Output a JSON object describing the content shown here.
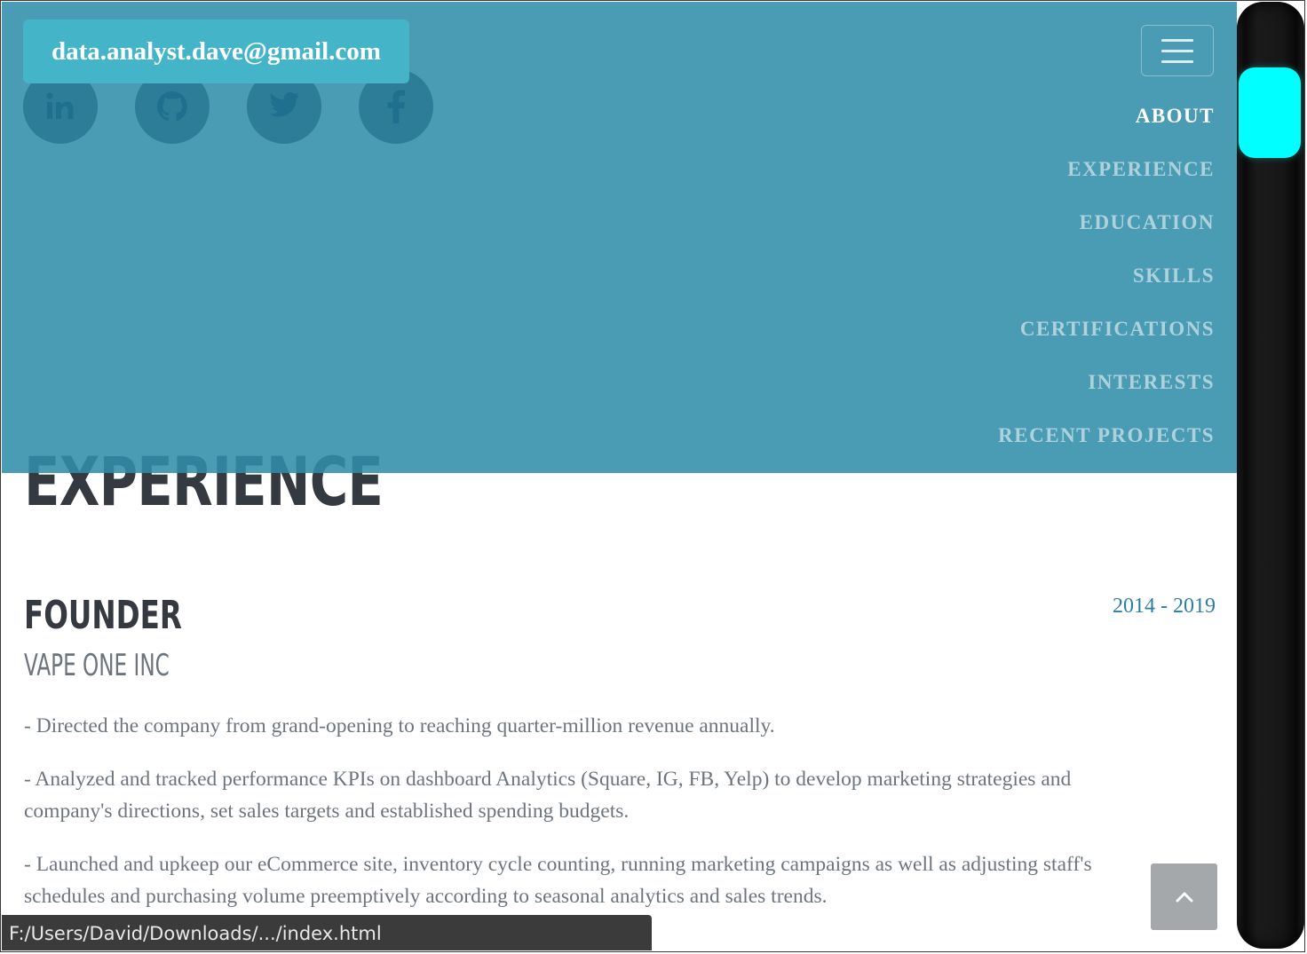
{
  "header": {
    "email": "data.analyst.dave@gmail.com",
    "social": [
      {
        "icon": "linkedin-icon"
      },
      {
        "icon": "github-icon"
      },
      {
        "icon": "twitter-icon"
      },
      {
        "icon": "facebook-icon"
      }
    ],
    "menu_icon": "hamburger-menu-icon"
  },
  "nav": {
    "items": [
      {
        "label": "ABOUT",
        "active": true
      },
      {
        "label": "EXPERIENCE",
        "active": false
      },
      {
        "label": "EDUCATION",
        "active": false
      },
      {
        "label": "SKILLS",
        "active": false
      },
      {
        "label": "CERTIFICATIONS",
        "active": false
      },
      {
        "label": "INTERESTS",
        "active": false
      },
      {
        "label": "RECENT PROJECTS",
        "active": false
      }
    ]
  },
  "section": {
    "title": "EXPERIENCE"
  },
  "job": {
    "title": "FOUNDER",
    "company": "VAPE ONE INC",
    "dates": "2014 - 2019",
    "duties": [
      "- Directed the company from grand-opening to reaching quarter-million revenue annually.",
      "- Analyzed and tracked performance KPIs on dashboard Analytics (Square, IG, FB, Yelp) to develop marketing strategies and company's directions, set sales targets and established spending budgets.",
      "- Launched and upkeep our eCommerce site, inventory cycle counting, running marketing campaigns as well as adjusting staff's schedules and purchasing volume preemptively according to seasonal analytics and sales trends."
    ]
  },
  "status_bar": {
    "url": "F:/Users/David/Downloads/.../index.html"
  },
  "back_to_top": {
    "icon": "chevron-up-icon"
  },
  "colors": {
    "nav_overlay": "#318daa",
    "email_chip": "#44b4c9",
    "heading": "#343a40",
    "muted_text": "#6c757d",
    "dates": "#2a7fa0",
    "scroll_thumb": "#00ffff"
  }
}
